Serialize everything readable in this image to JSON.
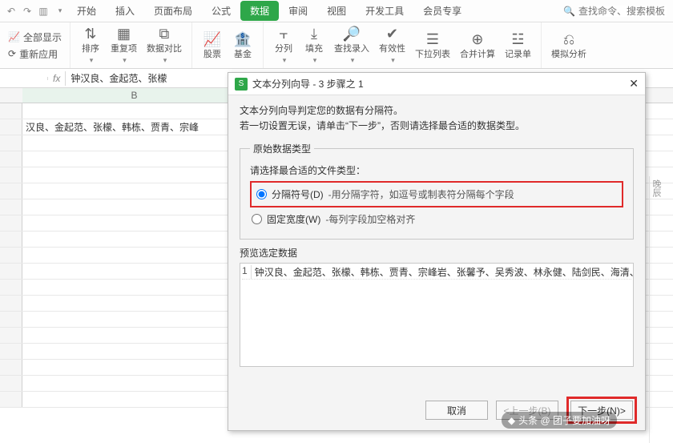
{
  "tabs": {
    "items": [
      "开始",
      "插入",
      "页面布局",
      "公式",
      "数据",
      "审阅",
      "视图",
      "开发工具",
      "会员专享"
    ],
    "active_index": 4,
    "search_placeholder": "查找命令、搜索模板"
  },
  "quick": {
    "show_all": "全部显示",
    "reapply": "重新应用"
  },
  "ribbon": {
    "sort": "排序",
    "dup": "重复项",
    "compare": "数据对比",
    "stock": "股票",
    "fund": "基金",
    "split": "分列",
    "fill": "填充",
    "find_input": "查找录入",
    "validity": "有效性",
    "dropdown": "下拉列表",
    "consolidate": "合并计算",
    "record": "记录单",
    "simulate": "模拟分析"
  },
  "fx": {
    "namebox": "",
    "content": "钟汉良、金起范、张檬"
  },
  "sheet": {
    "col": "B",
    "row1": "汉良、金起范、张檬、韩栋、贾青、宗峰"
  },
  "dialog": {
    "title": "文本分列向导 - 3 步骤之 1",
    "line1": "文本分列向导判定您的数据有分隔符。",
    "line2": "若一切设置无误，请单击“下一步”，否则请选择最合适的数据类型。",
    "group_title": "原始数据类型",
    "prompt": "请选择最合适的文件类型：",
    "opt1_label": "分隔符号(D)",
    "opt1_desc": "-用分隔字符，如逗号或制表符分隔每个字段",
    "opt2_label": "固定宽度(W)",
    "opt2_desc": "-每列字段加空格对齐",
    "preview_label": "预览选定数据",
    "preview_row_num": "1",
    "preview_row_text": "钟汉良、金起范、张檬、韩栋、贾青、宗峰岩、张馨予、吴秀波、林永健、陆剑民、海清、",
    "btn_cancel": "取消",
    "btn_prev": "<上一步(B)",
    "btn_next": "下一步(N)>"
  },
  "rightedge": "晚辰",
  "watermark": "头条 @ 团子要加油呀"
}
